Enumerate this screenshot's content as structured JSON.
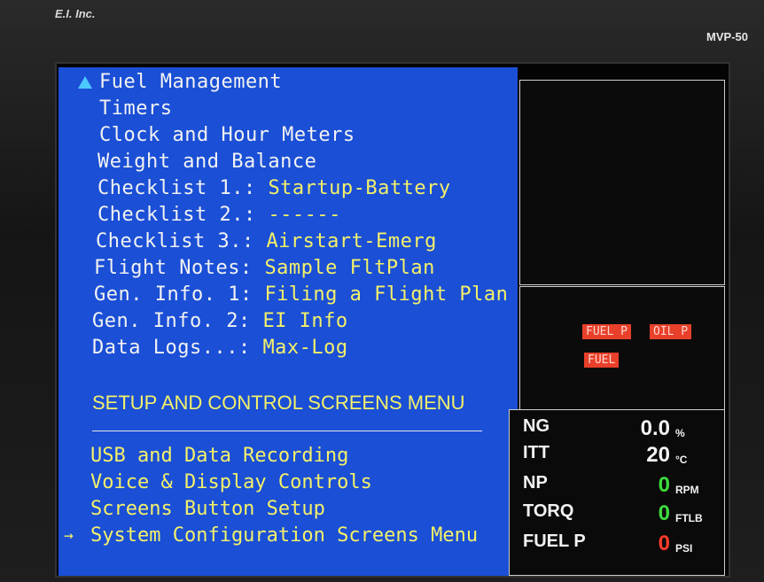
{
  "device": {
    "brand": "E.I. Inc.",
    "model": "MVP-50"
  },
  "menu": {
    "items": [
      {
        "label": "Fuel Management",
        "value": ""
      },
      {
        "label": "Timers",
        "value": ""
      },
      {
        "label": "Clock and Hour Meters",
        "value": ""
      },
      {
        "label": "Weight and Balance",
        "value": ""
      },
      {
        "label": "Checklist 1.: ",
        "value": "Startup-Battery"
      },
      {
        "label": "Checklist 2.: ",
        "value": "------"
      },
      {
        "label": "Checklist 3.: ",
        "value": "Airstart-Emerg"
      },
      {
        "label": "Flight Notes: ",
        "value": "Sample FltPlan"
      },
      {
        "label": "Gen. Info. 1: ",
        "value": "Filing a Flight Plan"
      },
      {
        "label": "Gen. Info. 2: ",
        "value": "EI Info"
      },
      {
        "label": "Data Logs...: ",
        "value": "Max-Log"
      }
    ],
    "setup_title": "SETUP AND CONTROL SCREENS MENU",
    "setup_items": [
      "USB and Data Recording",
      "Voice & Display Controls",
      "Screens Button Setup",
      "System Configuration Screens Menu"
    ]
  },
  "alarms": [
    "FUEL P",
    "OIL P",
    "FUEL"
  ],
  "params": [
    {
      "label": "NG",
      "value": "0.0",
      "unit": "%",
      "color": "#f2f2f2"
    },
    {
      "label": "ITT",
      "value": "20",
      "unit": "°C",
      "color": "#f2f2f2"
    },
    {
      "label": "NP",
      "value": "0",
      "unit": "RPM",
      "color": "#3ddc3d"
    },
    {
      "label": "TORQ",
      "value": "0",
      "unit": "FTLB",
      "color": "#3ddc3d"
    },
    {
      "label": "FUEL P",
      "value": "0",
      "unit": "PSI",
      "color": "#ff3b2a"
    }
  ]
}
